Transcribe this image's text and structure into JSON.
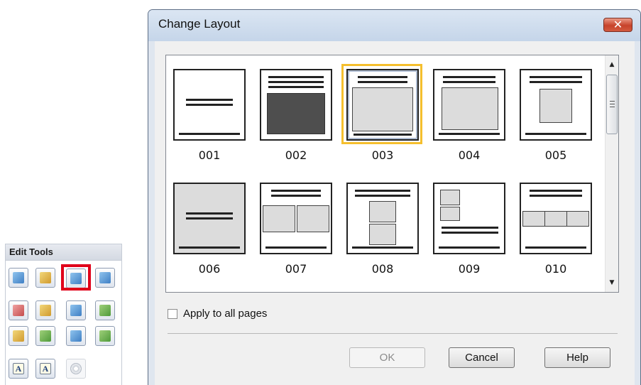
{
  "edit_tools": {
    "header": "Edit Tools",
    "buttons": [
      {
        "icon": "rotate-icon"
      },
      {
        "icon": "page-icon"
      },
      {
        "icon": "change-layout-icon",
        "highlighted": true
      },
      {
        "icon": "background-icon"
      },
      {
        "icon": "image-icon"
      },
      {
        "icon": "frame-icon"
      },
      {
        "icon": "layers-icon"
      },
      {
        "icon": "photo-icon"
      },
      {
        "icon": "calendar-icon"
      },
      {
        "icon": "date-icon"
      },
      {
        "icon": "shape-icon"
      },
      {
        "icon": "color-icon"
      },
      {
        "icon": "text-icon",
        "glyph": "A"
      },
      {
        "icon": "text-vertical-icon",
        "glyph": "A"
      },
      {
        "icon": "disc-icon",
        "disabled": true
      }
    ],
    "highlight_color": "#e0001a"
  },
  "dialog": {
    "title": "Change Layout",
    "close_glyph": "✕",
    "layouts": [
      {
        "label": "001",
        "selected": false
      },
      {
        "label": "002",
        "selected": false
      },
      {
        "label": "003",
        "selected": true
      },
      {
        "label": "004",
        "selected": false
      },
      {
        "label": "005",
        "selected": false
      },
      {
        "label": "006",
        "selected": false
      },
      {
        "label": "007",
        "selected": false
      },
      {
        "label": "008",
        "selected": false
      },
      {
        "label": "009",
        "selected": false
      },
      {
        "label": "010",
        "selected": false
      }
    ],
    "selection_color": "#f5bf2e",
    "scroll": {
      "up": "▲",
      "down": "▼"
    },
    "apply_all": {
      "label": "Apply to all pages",
      "checked": false
    },
    "buttons": {
      "ok": "OK",
      "cancel": "Cancel",
      "help": "Help"
    },
    "ok_disabled": true
  }
}
